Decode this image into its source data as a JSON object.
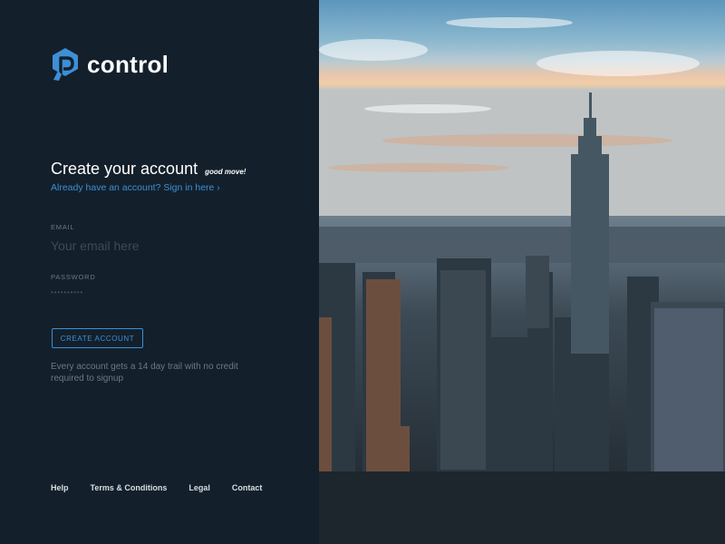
{
  "brand": {
    "name": "control",
    "logo_icon": "shield-p-icon",
    "accent_color": "#3d8fd6"
  },
  "signup": {
    "heading": "Create your account",
    "tagline": "good move!",
    "signin_link": "Already have an account? Sign in here  ›",
    "email": {
      "label": "EMAIL",
      "placeholder": "Your email here",
      "value": ""
    },
    "password": {
      "label": "PASSWORD",
      "masked_value": "••••••••••"
    },
    "create_button": "CREATE ACCOUNT",
    "trial_note": "Every account gets a 14 day trail with no credit required to signup"
  },
  "footer": {
    "links": [
      "Help",
      "Terms & Conditions",
      "Legal",
      "Contact"
    ]
  },
  "colors": {
    "panel_bg": "#13202b",
    "text_muted": "#6b7886"
  }
}
